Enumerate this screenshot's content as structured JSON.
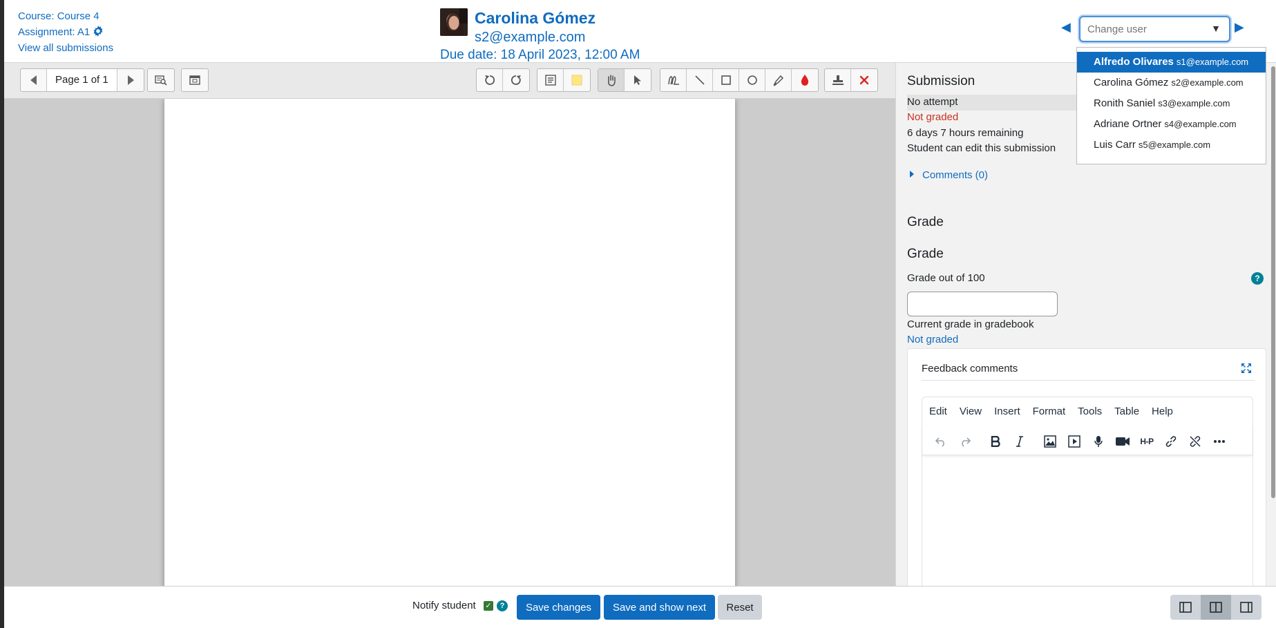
{
  "header": {
    "course_link": "Course: Course 4",
    "assignment_link": "Assignment: A1",
    "view_all": "View all submissions",
    "user_name": "Carolina Gómez",
    "user_email": "s2@example.com",
    "due_date": "Due date: 18 April 2023, 12:00 AM",
    "change_user_placeholder": "Change user",
    "prev_arrow": "◀",
    "next_arrow": "▶",
    "caret": "▼"
  },
  "user_dropdown": {
    "items": [
      {
        "name": "Alfredo Olivares",
        "email": "s1@example.com",
        "selected": true
      },
      {
        "name": "Carolina Gómez",
        "email": "s2@example.com",
        "selected": false
      },
      {
        "name": "Ronith Saniel",
        "email": "s3@example.com",
        "selected": false
      },
      {
        "name": "Adriane Ortner",
        "email": "s4@example.com",
        "selected": false
      },
      {
        "name": "Luis Carr",
        "email": "s5@example.com",
        "selected": false
      }
    ]
  },
  "toolbar": {
    "page_label": "Page 1 of 1",
    "icons": {
      "prev_page": "previous-page-icon",
      "next_page": "next-page-icon",
      "search_comments": "search-comments-icon",
      "expand": "expand-icon",
      "rotate_left": "rotate-left-icon",
      "rotate_right": "rotate-right-icon",
      "comment": "comment-icon",
      "highlight": "highlight-color-icon",
      "pan": "hand-icon",
      "select": "pointer-icon",
      "pen": "pen-icon",
      "line": "line-icon",
      "rectangle": "rectangle-icon",
      "oval": "oval-icon",
      "highlighter": "highlighter-icon",
      "annotation_color": "ink-drop-icon",
      "stamp": "stamp-icon",
      "clear": "delete-icon"
    }
  },
  "panel": {
    "submission_heading": "Submission",
    "status_attempt": "No attempt",
    "status_grade": "Not graded",
    "time_remaining": "6 days 7 hours remaining",
    "edit_status": "Student can edit this submission",
    "comments_link": "Comments (0)",
    "grade_heading_1": "Grade",
    "grade_heading_2": "Grade",
    "grade_out_of": "Grade out of 100",
    "grade_value": "",
    "current_grade_label": "Current grade in gradebook",
    "current_grade_value": "Not graded",
    "help_glyph": "?",
    "feedback_title": "Feedback comments",
    "editor_menu": [
      "Edit",
      "View",
      "Insert",
      "Format",
      "Tools",
      "Table",
      "Help"
    ],
    "hp_label": "H-P"
  },
  "footer": {
    "notify_label": "Notify student",
    "notify_checked": true,
    "check_glyph": "✓",
    "help_glyph": "?",
    "save_changes": "Save changes",
    "save_next": "Save and show next",
    "reset": "Reset"
  },
  "colors": {
    "link": "#0f6cbf",
    "danger": "#ca3120",
    "primary_button": "#0f6cbf",
    "help_icon": "#008196",
    "checkbox": "#357a32"
  }
}
